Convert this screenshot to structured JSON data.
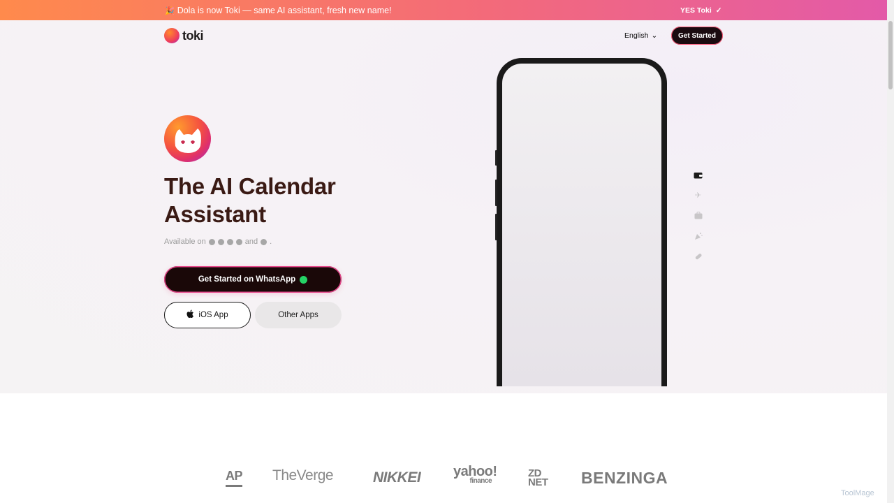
{
  "banner": {
    "text": "Dola is now Toki — same AI assistant, fresh new name!",
    "cta": "YES Toki"
  },
  "nav": {
    "logo_text": "toki",
    "language": "English",
    "cta": "Get Started"
  },
  "hero": {
    "headline_line1": "The AI Calendar",
    "headline_line2": "Assistant",
    "available_prefix": "Available on",
    "available_and": "and",
    "available_end": ".",
    "whatsapp_button": "Get Started on WhatsApp",
    "ios_button": "iOS App",
    "other_button": "Other Apps"
  },
  "side_icons": [
    "wallet-icon",
    "plane-icon",
    "briefcase-icon",
    "party-icon",
    "pill-icon"
  ],
  "press": [
    "AP",
    "TheVerge",
    "NIKKEI",
    "yahoo!",
    "finance",
    "ZD",
    "NET",
    "BENZINGA"
  ],
  "watermark": "ToolMage"
}
